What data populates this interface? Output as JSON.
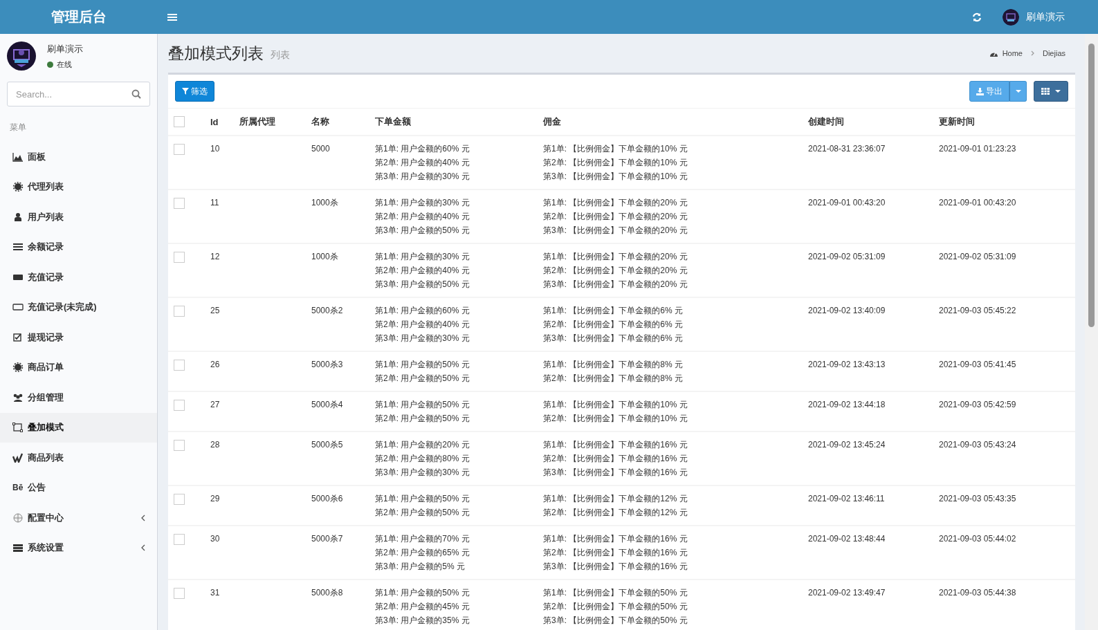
{
  "header": {
    "brand": "管理后台",
    "user_name": "刷单演示"
  },
  "sidebar": {
    "user": {
      "name": "刷单演示",
      "status": "在线",
      "online": true
    },
    "search": {
      "placeholder": "Search..."
    },
    "menu_title": "菜单",
    "items": [
      {
        "label": "面板",
        "selected": false,
        "has_submenu": false
      },
      {
        "label": "代理列表",
        "selected": false,
        "has_submenu": false
      },
      {
        "label": "用户列表",
        "selected": false,
        "has_submenu": false
      },
      {
        "label": "余额记录",
        "selected": false,
        "has_submenu": false
      },
      {
        "label": "充值记录",
        "selected": false,
        "has_submenu": false
      },
      {
        "label": "充值记录(未完成)",
        "selected": false,
        "has_submenu": false
      },
      {
        "label": "提现记录",
        "selected": false,
        "has_submenu": false
      },
      {
        "label": "商品订单",
        "selected": false,
        "has_submenu": false
      },
      {
        "label": "分组管理",
        "selected": false,
        "has_submenu": false
      },
      {
        "label": "叠加模式",
        "selected": true,
        "has_submenu": false
      },
      {
        "label": "商品列表",
        "selected": false,
        "has_submenu": false
      },
      {
        "label": "公告",
        "selected": false,
        "has_submenu": false,
        "glyph": "Bē"
      },
      {
        "label": "配置中心",
        "selected": false,
        "has_submenu": true
      },
      {
        "label": "系统设置",
        "selected": false,
        "has_submenu": true
      }
    ]
  },
  "page": {
    "title": "叠加模式列表",
    "subtitle": "列表",
    "breadcrumb": [
      "Home",
      "Diejias"
    ]
  },
  "toolbar": {
    "filter": "筛选",
    "export": "导出"
  },
  "table": {
    "columns": [
      "Id",
      "所属代理",
      "名称",
      "下单金额",
      "佣金",
      "创建时间",
      "更新时间"
    ],
    "all_checked": false,
    "rows": [
      {
        "checked": false,
        "id": "10",
        "name": "5000",
        "amounts": [
          "第1单: 用户金额的60% 元",
          "第2单: 用户金额的40% 元",
          "第3单: 用户金额的30% 元"
        ],
        "commissions": [
          "第1单: 【比例佣金】下单金额的10% 元",
          "第2单: 【比例佣金】下单金额的10% 元",
          "第3单: 【比例佣金】下单金额的10% 元"
        ],
        "created": "2021-08-31 23:36:07",
        "updated": "2021-09-01 01:23:23"
      },
      {
        "checked": false,
        "id": "11",
        "name": "1000杀",
        "amounts": [
          "第1单: 用户金额的30% 元",
          "第2单: 用户金额的40% 元",
          "第3单: 用户金额的50% 元"
        ],
        "commissions": [
          "第1单: 【比例佣金】下单金额的20% 元",
          "第2单: 【比例佣金】下单金额的20% 元",
          "第3单: 【比例佣金】下单金额的20% 元"
        ],
        "created": "2021-09-01 00:43:20",
        "updated": "2021-09-01 00:43:20"
      },
      {
        "checked": false,
        "id": "12",
        "name": "1000杀",
        "amounts": [
          "第1单: 用户金额的30% 元",
          "第2单: 用户金额的40% 元",
          "第3单: 用户金额的50% 元"
        ],
        "commissions": [
          "第1单: 【比例佣金】下单金额的20% 元",
          "第2单: 【比例佣金】下单金额的20% 元",
          "第3单: 【比例佣金】下单金额的20% 元"
        ],
        "created": "2021-09-02 05:31:09",
        "updated": "2021-09-02 05:31:09"
      },
      {
        "checked": false,
        "id": "25",
        "name": "5000杀2",
        "amounts": [
          "第1单: 用户金额的60% 元",
          "第2单: 用户金额的40% 元",
          "第3单: 用户金额的30% 元"
        ],
        "commissions": [
          "第1单: 【比例佣金】下单金额的6% 元",
          "第2单: 【比例佣金】下单金额的6% 元",
          "第3单: 【比例佣金】下单金额的6% 元"
        ],
        "created": "2021-09-02 13:40:09",
        "updated": "2021-09-03 05:45:22"
      },
      {
        "checked": false,
        "id": "26",
        "name": "5000杀3",
        "amounts": [
          "第1单: 用户金额的50% 元",
          "第2单: 用户金额的50% 元"
        ],
        "commissions": [
          "第1单: 【比例佣金】下单金额的8% 元",
          "第2单: 【比例佣金】下单金额的8% 元"
        ],
        "created": "2021-09-02 13:43:13",
        "updated": "2021-09-03 05:41:45"
      },
      {
        "checked": false,
        "id": "27",
        "name": "5000杀4",
        "amounts": [
          "第1单: 用户金额的50% 元",
          "第2单: 用户金额的50% 元"
        ],
        "commissions": [
          "第1单: 【比例佣金】下单金额的10% 元",
          "第2单: 【比例佣金】下单金额的10% 元"
        ],
        "created": "2021-09-02 13:44:18",
        "updated": "2021-09-03 05:42:59"
      },
      {
        "checked": false,
        "id": "28",
        "name": "5000杀5",
        "amounts": [
          "第1单: 用户金额的20% 元",
          "第2单: 用户金额的80% 元",
          "第3单: 用户金额的30% 元"
        ],
        "commissions": [
          "第1单: 【比例佣金】下单金额的16% 元",
          "第2单: 【比例佣金】下单金额的16% 元",
          "第3单: 【比例佣金】下单金额的16% 元"
        ],
        "created": "2021-09-02 13:45:24",
        "updated": "2021-09-03 05:43:24"
      },
      {
        "checked": false,
        "id": "29",
        "name": "5000杀6",
        "amounts": [
          "第1单: 用户金额的50% 元",
          "第2单: 用户金额的50% 元"
        ],
        "commissions": [
          "第1单: 【比例佣金】下单金额的12% 元",
          "第2单: 【比例佣金】下单金额的12% 元"
        ],
        "created": "2021-09-02 13:46:11",
        "updated": "2021-09-03 05:43:35"
      },
      {
        "checked": false,
        "id": "30",
        "name": "5000杀7",
        "amounts": [
          "第1单: 用户金额的70% 元",
          "第2单: 用户金额的65% 元",
          "第3单: 用户金额的5% 元"
        ],
        "commissions": [
          "第1单: 【比例佣金】下单金额的16% 元",
          "第2单: 【比例佣金】下单金额的16% 元",
          "第3单: 【比例佣金】下单金额的16% 元"
        ],
        "created": "2021-09-02 13:48:44",
        "updated": "2021-09-03 05:44:02"
      },
      {
        "checked": false,
        "id": "31",
        "name": "5000杀8",
        "amounts": [
          "第1单: 用户金额的50% 元",
          "第2单: 用户金额的45% 元",
          "第3单: 用户金额的35% 元"
        ],
        "commissions": [
          "第1单: 【比例佣金】下单金额的50% 元",
          "第2单: 【比例佣金】下单金额的50% 元",
          "第3单: 【比例佣金】下单金额的50% 元"
        ],
        "created": "2021-09-02 13:49:47",
        "updated": "2021-09-03 05:44:38"
      }
    ]
  }
}
